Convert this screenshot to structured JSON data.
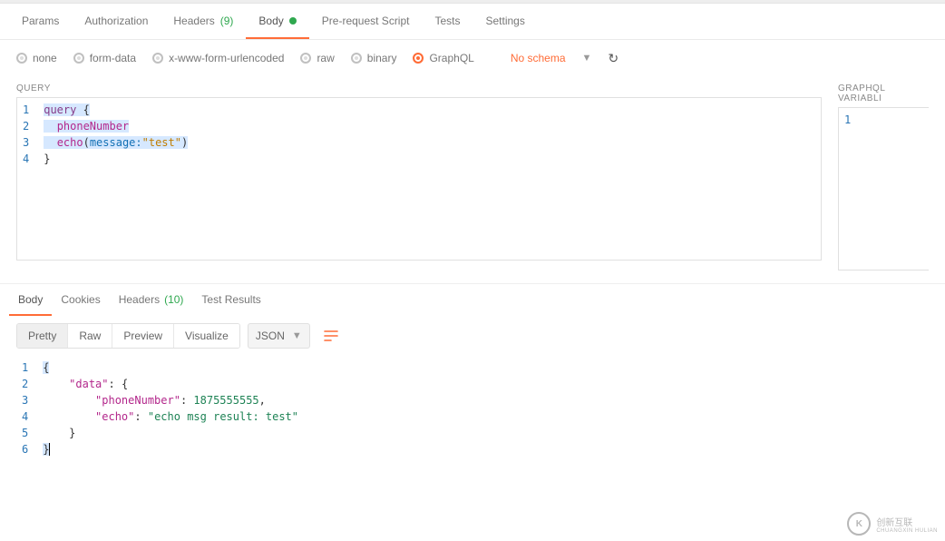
{
  "requestTabs": {
    "params": "Params",
    "authorization": "Authorization",
    "headers": "Headers",
    "headersCount": "(9)",
    "body": "Body",
    "prerequest": "Pre-request Script",
    "tests": "Tests",
    "settings": "Settings"
  },
  "bodyTypes": {
    "none": "none",
    "formdata": "form-data",
    "xwww": "x-www-form-urlencoded",
    "raw": "raw",
    "binary": "binary",
    "graphql": "GraphQL",
    "noschema": "No schema"
  },
  "query": {
    "label": "QUERY",
    "lines": [
      "1",
      "2",
      "3",
      "4"
    ],
    "l1_kw": "query",
    "l1_brace": " {",
    "l2": "phoneNumber",
    "l3_fn": "echo",
    "l3_open": "(",
    "l3_arg": "message:",
    "l3_str": "\"test\"",
    "l3_close": ")",
    "l4": "}"
  },
  "variables": {
    "label": "GRAPHQL VARIABLI",
    "lines": [
      "1"
    ]
  },
  "respTabs": {
    "body": "Body",
    "cookies": "Cookies",
    "headers": "Headers",
    "headersCount": "(10)",
    "testresults": "Test Results"
  },
  "respToolbar": {
    "pretty": "Pretty",
    "raw": "Raw",
    "preview": "Preview",
    "visualize": "Visualize",
    "format": "JSON"
  },
  "response": {
    "lines": [
      "1",
      "2",
      "3",
      "4",
      "5",
      "6"
    ],
    "l1": "{",
    "l2_key": "\"data\"",
    "l2_colon": ": {",
    "l3_key": "\"phoneNumber\"",
    "l3_colon": ": ",
    "l3_val": "1875555555",
    "l3_comma": ",",
    "l4_key": "\"echo\"",
    "l4_colon": ": ",
    "l4_val": "\"echo msg result: test\"",
    "l5": "}",
    "l6": "}"
  },
  "watermark": {
    "k": "K",
    "t1": "创新互联",
    "t2": "CHUANGXIN HULIAN"
  }
}
